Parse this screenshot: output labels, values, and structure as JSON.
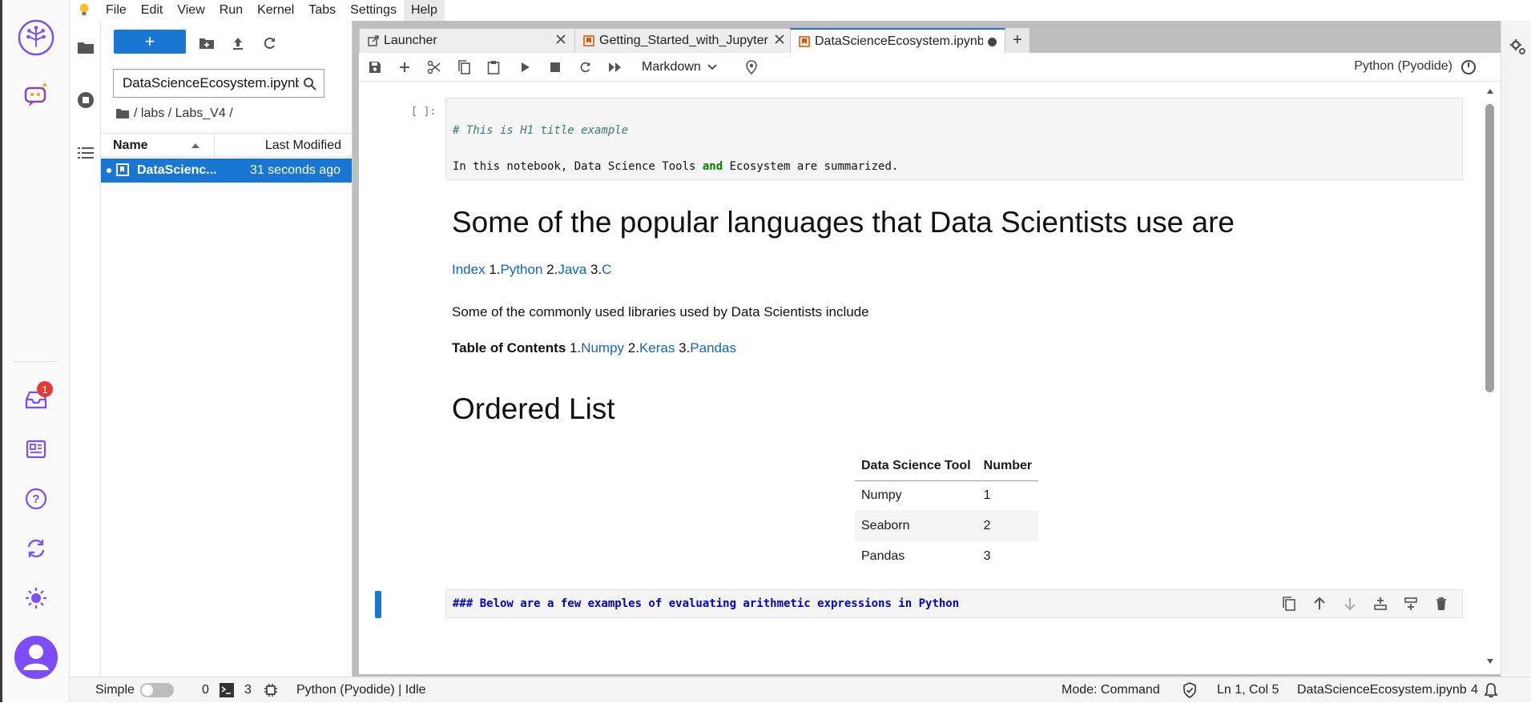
{
  "menubar": {
    "items": [
      "File",
      "Edit",
      "View",
      "Run",
      "Kernel",
      "Tabs",
      "Settings",
      "Help"
    ]
  },
  "activity": {
    "notification_count": "1"
  },
  "filebrowser": {
    "filter_value": "DataScienceEcosystem.ipynb",
    "breadcrumb": "/ labs / Labs_V4 /",
    "col_name": "Name",
    "col_modified": "Last Modified",
    "files": [
      {
        "name": "DataScienceEcosystem.ipynb",
        "display_name": "DataScienc...",
        "modified": "31 seconds ago"
      }
    ]
  },
  "tabs": [
    {
      "label": "Launcher",
      "icon": "launcher-icon"
    },
    {
      "label": "Getting_Started_with_Jupyter",
      "icon": "notebook-icon"
    },
    {
      "label": "DataScienceEcosystem.ipynb",
      "icon": "notebook-icon",
      "current": true
    }
  ],
  "toolbar": {
    "cell_type": "Markdown",
    "kernel_name": "Python (Pyodide)"
  },
  "cells": {
    "c1_prompt": "[ ]:",
    "c1_line1": "# This is H1 title example",
    "c1_line2_a": "In this notebook, Data Science Tools ",
    "c1_line2_kw": "and",
    "c1_line2_b": " Ecosystem are summarized.",
    "h1": "Some of the popular languages that Data Scientists use are",
    "lang_index": "Index",
    "lang_items": [
      {
        "num": " 1.",
        "name": "Python"
      },
      {
        "num": " 2.",
        "name": "Java"
      },
      {
        "num": " 3.",
        "name": "C"
      }
    ],
    "libs_intro": "Some of the commonly used libraries used by Data Scientists include",
    "toc_label": "Table of Contents",
    "toc_items": [
      {
        "num": " 1.",
        "name": "Numpy"
      },
      {
        "num": " 2.",
        "name": "Keras"
      },
      {
        "num": " 3.",
        "name": "Pandas"
      }
    ],
    "h2": "Ordered List",
    "table": {
      "headers": [
        "Data Science Tool",
        "Number"
      ],
      "rows": [
        [
          "Numpy",
          "1"
        ],
        [
          "Seaborn",
          "2"
        ],
        [
          "Pandas",
          "3"
        ]
      ]
    },
    "active_cell_source": "### Below are a few examples of evaluating arithmetic expressions in Python"
  },
  "statusbar": {
    "mode_label": "Simple",
    "terminals": "0",
    "kernels": "3",
    "kernel_status": "Python (Pyodide) | Idle",
    "mode": "Mode: Command",
    "cursor": "Ln 1, Col 5",
    "filename": "DataScienceEcosystem.ipynb",
    "notifications": "4"
  },
  "colors": {
    "accent": "#1976d2",
    "link": "#1565c0",
    "code_keyword": "#008000",
    "comment": "#3d7a7a",
    "md_source": "#0000cc"
  }
}
